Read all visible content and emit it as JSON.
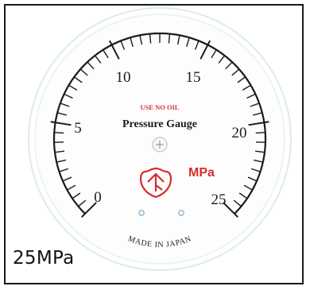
{
  "gauge": {
    "scale_labels": [
      "0",
      "5",
      "10",
      "15",
      "20",
      "25"
    ],
    "scale_min": 0,
    "scale_max": 25,
    "warning_text": "USE NO OIL",
    "title": "Pressure Gauge",
    "unit": "MPa",
    "origin_text": "MADE IN JAPAN",
    "zero_screw_icon": "plus-screw-icon",
    "logo_icon": "red-emblem-icon"
  },
  "caption": "25MPa",
  "colors": {
    "dial_ring": "#dcecea",
    "ink": "#1b1b1b",
    "brand_red": "#d92b2b",
    "pin_blue": "#8fb3c8",
    "frame": "#1a1a1a"
  }
}
